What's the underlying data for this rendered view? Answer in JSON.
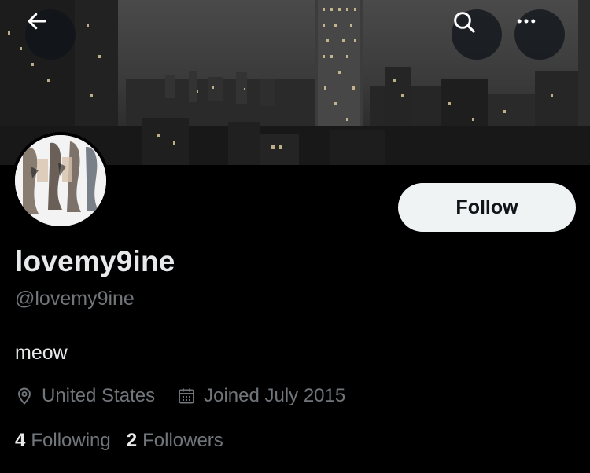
{
  "header": {
    "back_icon": "arrow-left-icon",
    "search_icon": "search-icon",
    "more_icon": "more-horizontal-icon"
  },
  "profile": {
    "display_name": "lovemy9ine",
    "handle": "@lovemy9ine",
    "bio": "meow",
    "location": "United States",
    "joined": "Joined July 2015",
    "following_count": "4",
    "following_label": "Following",
    "followers_count": "2",
    "followers_label": "Followers"
  },
  "actions": {
    "follow_label": "Follow"
  },
  "colors": {
    "background": "#000000",
    "text_primary": "#e7e9ea",
    "text_secondary": "#71767b",
    "follow_button_bg": "#eff3f4"
  }
}
